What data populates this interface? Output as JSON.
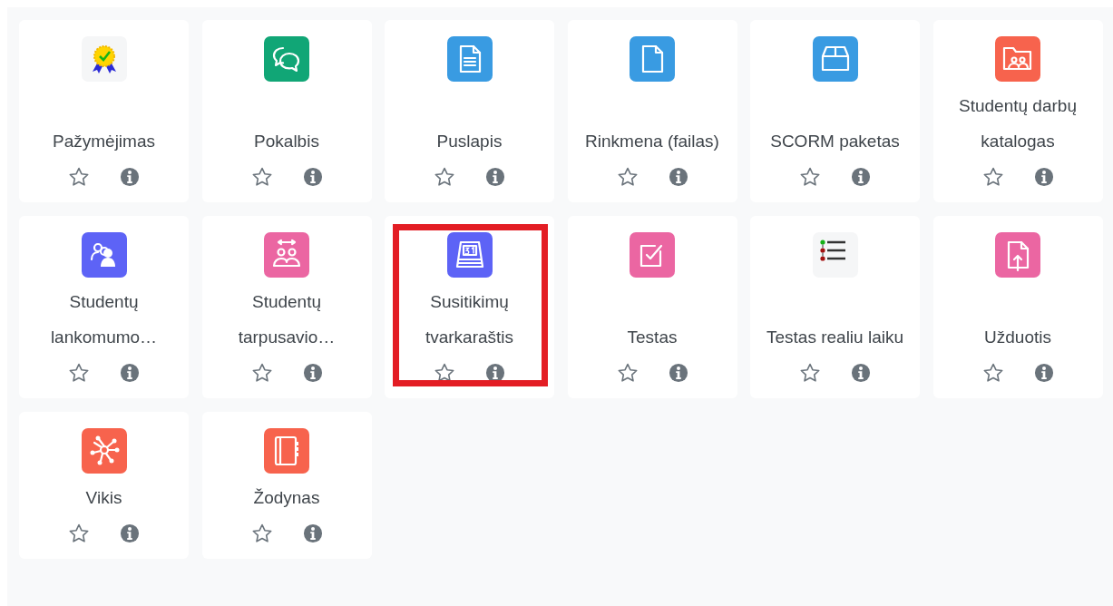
{
  "activities": [
    {
      "name": "Pažymėjimas",
      "kind": "certificate",
      "color": "#f5f6f7",
      "starred": false,
      "highlighted": false
    },
    {
      "name": "Pokalbis",
      "kind": "chat",
      "color": "#11a676",
      "starred": false,
      "highlighted": false
    },
    {
      "name": "Puslapis",
      "kind": "page",
      "color": "#399be2",
      "starred": false,
      "highlighted": false
    },
    {
      "name": "Rinkmena (failas)",
      "kind": "file",
      "color": "#399be2",
      "starred": false,
      "highlighted": false
    },
    {
      "name": "SCORM paketas",
      "kind": "package",
      "color": "#399be2",
      "starred": false,
      "highlighted": false
    },
    {
      "name": "Studentų darbų katalogas",
      "kind": "folder",
      "color": "#f7634d",
      "starred": false,
      "highlighted": false
    },
    {
      "name": "Studentų lankomumo…",
      "kind": "attendance",
      "color": "#5d63f6",
      "starred": false,
      "highlighted": false
    },
    {
      "name": "Studentų tarpusavio…",
      "kind": "workshop",
      "color": "#eb66a2",
      "starred": false,
      "highlighted": false
    },
    {
      "name": "Susitikimų tvarkaraštis",
      "kind": "scheduler",
      "color": "#5d63f6",
      "starred": false,
      "highlighted": true
    },
    {
      "name": "Testas",
      "kind": "quiz",
      "color": "#eb66a2",
      "starred": false,
      "highlighted": false
    },
    {
      "name": "Testas realiu laiku",
      "kind": "livequiz",
      "color": "#f5f6f7",
      "starred": false,
      "highlighted": false
    },
    {
      "name": "Užduotis",
      "kind": "assignment",
      "color": "#eb66a2",
      "starred": false,
      "highlighted": false
    },
    {
      "name": "Vikis",
      "kind": "wiki",
      "color": "#f7634d",
      "starred": false,
      "highlighted": false
    },
    {
      "name": "Žodynas",
      "kind": "glossary",
      "color": "#f7634d",
      "starred": false,
      "highlighted": false
    }
  ]
}
